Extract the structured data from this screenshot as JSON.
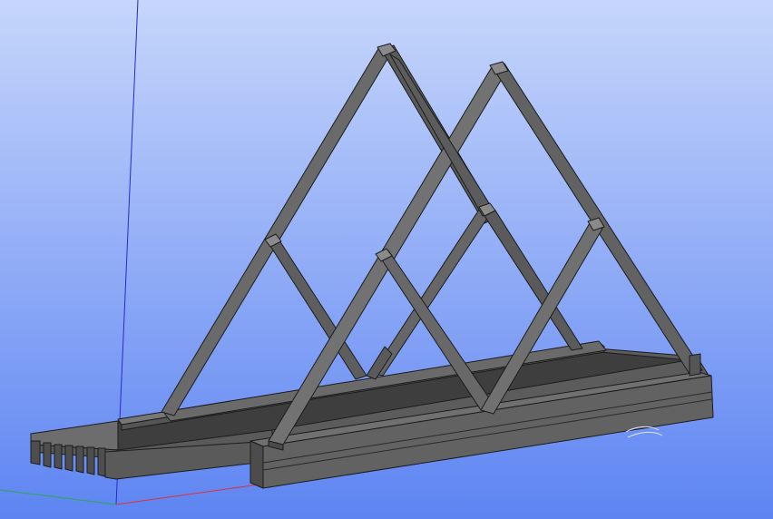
{
  "viewport": {
    "background_top": "#c6d6fb",
    "background_bottom": "#5d84f2"
  },
  "axes": {
    "x_color": "#e0303a",
    "y_color": "#2fa84a",
    "z_color": "#2a2acb"
  },
  "model": {
    "name": "truss-bridge",
    "face_light": "#747474",
    "face_mid": "#5f5f5f",
    "face_dark": "#4a4a4a",
    "face_top": "#6a6a6a",
    "edge_color": "#1c1c1c",
    "deck_surface": "#3e3e3e"
  }
}
